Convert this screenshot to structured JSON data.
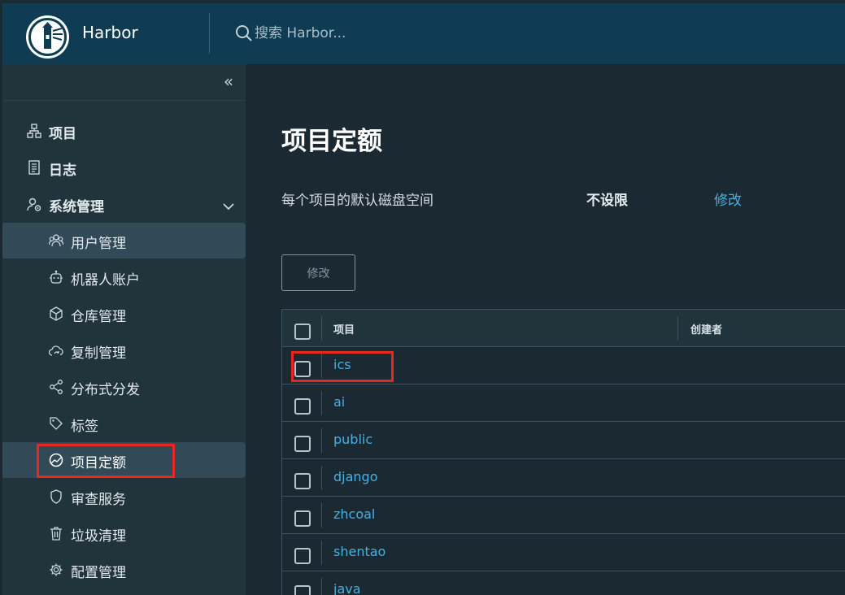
{
  "header": {
    "brand": "Harbor",
    "search_placeholder": "搜索 Harbor..."
  },
  "sidebar": {
    "items": [
      {
        "label": "项目",
        "icon": "project-tree-icon"
      },
      {
        "label": "日志",
        "icon": "log-icon"
      },
      {
        "label": "系统管理",
        "icon": "users-gear-icon",
        "expanded": true
      }
    ],
    "sub_items": [
      {
        "label": "用户管理",
        "icon": "users-icon"
      },
      {
        "label": "机器人账户",
        "icon": "robot-icon"
      },
      {
        "label": "仓库管理",
        "icon": "cube-icon"
      },
      {
        "label": "复制管理",
        "icon": "cloud-sync-icon"
      },
      {
        "label": "分布式分发",
        "icon": "share-icon"
      },
      {
        "label": "标签",
        "icon": "tag-icon"
      },
      {
        "label": "项目定额",
        "icon": "pie-chart-icon",
        "selected": true
      },
      {
        "label": "审查服务",
        "icon": "shield-icon"
      },
      {
        "label": "垃圾清理",
        "icon": "trash-icon"
      },
      {
        "label": "配置管理",
        "icon": "gear-icon"
      }
    ]
  },
  "main": {
    "title": "项目定额",
    "default_quota_label": "每个项目的默认磁盘空间",
    "default_quota_value": "不设限",
    "default_quota_edit": "修改",
    "edit_button": "修改",
    "table": {
      "columns": [
        "项目",
        "创建者"
      ],
      "rows": [
        "ics",
        "ai",
        "public",
        "django",
        "zhcoal",
        "shentao",
        "java"
      ]
    }
  },
  "colors": {
    "header_bg": "#0f3c53",
    "sidebar_bg": "#21333b",
    "content_bg": "#1b2a32",
    "link": "#4aaede",
    "highlight_box": "#e8271f"
  }
}
